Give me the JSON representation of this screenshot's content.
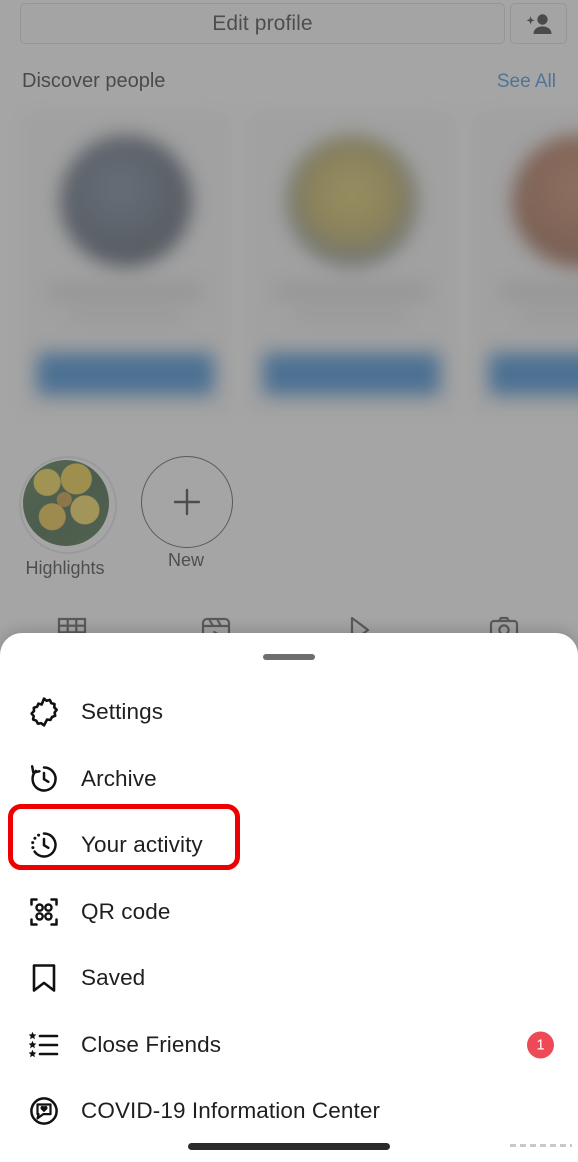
{
  "profile_header": {
    "edit_profile_label": "Edit profile",
    "add_person_icon": "add-person-icon"
  },
  "discover": {
    "title": "Discover people",
    "see_all_label": "See All",
    "cards": [
      {
        "avatar_tone": "#39475a",
        "follow_label": ""
      },
      {
        "avatar_tone": "#b9a23f",
        "follow_label": ""
      },
      {
        "avatar_tone": "#8e4a2c",
        "follow_label": ""
      }
    ]
  },
  "highlights": {
    "highlight_label": "Highlights",
    "new_label": "New",
    "new_icon": "plus-icon"
  },
  "profile_tabs": [
    {
      "name": "grid-tab",
      "icon": "grid-icon"
    },
    {
      "name": "reels-tab",
      "icon": "reels-icon"
    },
    {
      "name": "igtv-tab",
      "icon": "igtv-play-icon"
    },
    {
      "name": "tagged-tab",
      "icon": "tagged-person-icon"
    }
  ],
  "sheet": {
    "grabber": "drag-handle",
    "items": [
      {
        "label": "Settings",
        "icon": "gear-icon",
        "badge": ""
      },
      {
        "label": "Archive",
        "icon": "archive-clock-icon",
        "badge": ""
      },
      {
        "label": "Your activity",
        "icon": "activity-clock-icon",
        "badge": ""
      },
      {
        "label": "QR code",
        "icon": "qr-code-icon",
        "badge": ""
      },
      {
        "label": "Saved",
        "icon": "bookmark-icon",
        "badge": ""
      },
      {
        "label": "Close Friends",
        "icon": "star-list-icon",
        "badge": "1"
      },
      {
        "label": "COVID-19 Information Center",
        "icon": "covid-heart-icon",
        "badge": ""
      }
    ],
    "highlight_target": "Your activity",
    "highlight_color": "#ef0000",
    "badge_color": "#ED4956"
  },
  "system": {
    "home_indicator": "home-indicator"
  }
}
